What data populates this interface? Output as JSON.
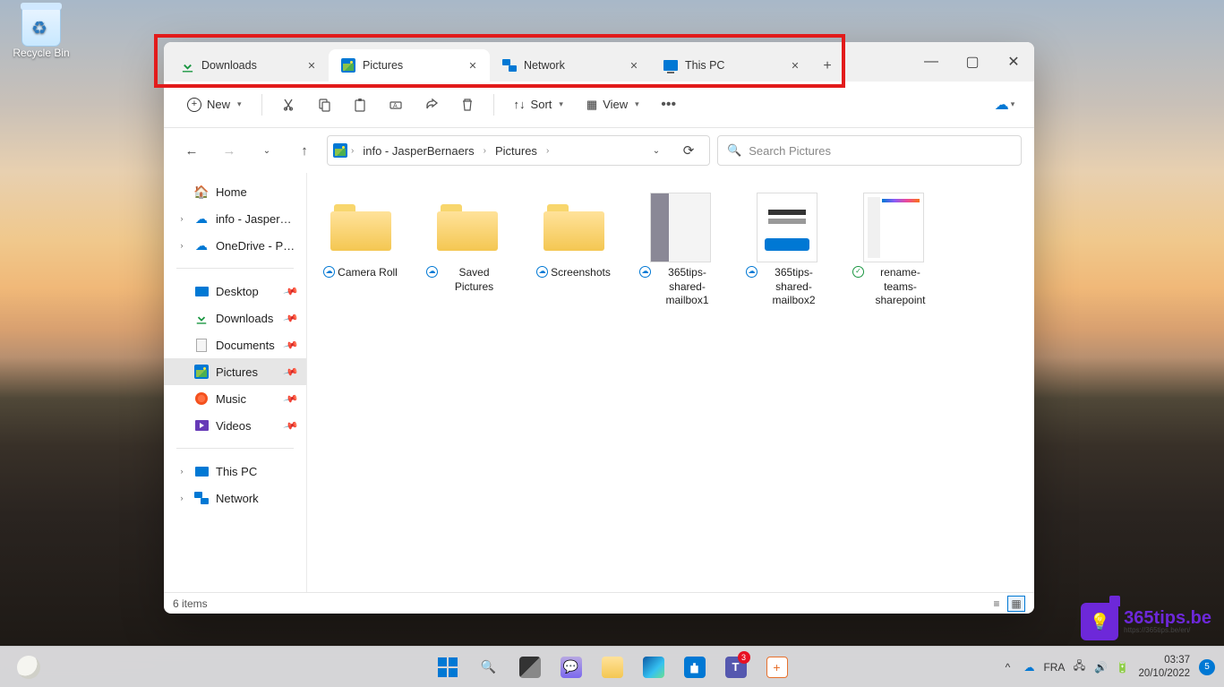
{
  "desktop": {
    "recycle_bin": "Recycle Bin"
  },
  "window": {
    "tabs": [
      {
        "label": "Downloads",
        "icon": "download",
        "active": false
      },
      {
        "label": "Pictures",
        "icon": "pictures",
        "active": true
      },
      {
        "label": "Network",
        "icon": "network",
        "active": false
      },
      {
        "label": "This PC",
        "icon": "pc",
        "active": false
      }
    ],
    "toolbar": {
      "new_label": "New",
      "sort_label": "Sort",
      "view_label": "View"
    },
    "breadcrumbs": {
      "root_icon": "pictures",
      "segments": [
        "info - JasperBernaers",
        "Pictures"
      ]
    },
    "search_placeholder": "Search Pictures",
    "sidebar": {
      "top": [
        {
          "label": "Home",
          "icon": "home",
          "expandable": false
        },
        {
          "label": "info - JasperBernae",
          "icon": "cloud",
          "expandable": true
        },
        {
          "label": "OneDrive - Persona",
          "icon": "cloud",
          "expandable": true
        }
      ],
      "quick": [
        {
          "label": "Desktop",
          "icon": "desktop",
          "pinned": true
        },
        {
          "label": "Downloads",
          "icon": "download",
          "pinned": true
        },
        {
          "label": "Documents",
          "icon": "doc",
          "pinned": true
        },
        {
          "label": "Pictures",
          "icon": "pictures",
          "pinned": true,
          "selected": true
        },
        {
          "label": "Music",
          "icon": "music",
          "pinned": true
        },
        {
          "label": "Videos",
          "icon": "video",
          "pinned": true
        }
      ],
      "bottom": [
        {
          "label": "This PC",
          "icon": "pc",
          "expandable": true
        },
        {
          "label": "Network",
          "icon": "network",
          "expandable": true
        }
      ]
    },
    "items": [
      {
        "name": "Camera Roll",
        "type": "folder",
        "status": "cloud"
      },
      {
        "name": "Saved Pictures",
        "type": "folder",
        "status": "cloud"
      },
      {
        "name": "Screenshots",
        "type": "folder",
        "status": "cloud"
      },
      {
        "name": "365tips-shared-mailbox1",
        "type": "image",
        "thumb": "t1",
        "status": "cloud"
      },
      {
        "name": "365tips-shared-mailbox2",
        "type": "image",
        "thumb": "t2",
        "status": "cloud"
      },
      {
        "name": "rename-teams-sharepoint",
        "type": "image",
        "thumb": "t3",
        "status": "check"
      }
    ],
    "status_text": "6 items"
  },
  "taskbar": {
    "lang": "FRA",
    "teams_badge": "3",
    "time": "03:37",
    "date": "20/10/2022",
    "notif_count": "5"
  },
  "watermark": {
    "brand": "365tips.be",
    "sub": "https://365tips.be/en/"
  }
}
